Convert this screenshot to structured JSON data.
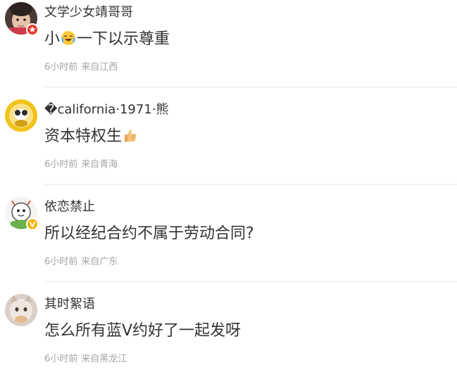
{
  "comments": [
    {
      "username": "文学少女靖哥哥",
      "content_before": "小",
      "emoji": "crying-laughing-emoji",
      "content_after": "一下以示尊重",
      "time": "6小时前",
      "location": "来自江西",
      "badge": "red-star-badge"
    },
    {
      "username": "�california·1971·熊",
      "content_before": "资本特权生",
      "emoji": "thumbs-up-emoji",
      "content_after": "",
      "time": "6小时前",
      "location": "来自青海",
      "badge": ""
    },
    {
      "username": "依恋禁止",
      "content_before": "所以经纪合约不属于劳动合同?",
      "emoji": "",
      "content_after": "",
      "time": "6小时前",
      "location": "来自广东",
      "badge": "yellow-v-badge"
    },
    {
      "username": "其时絮语",
      "content_before": "怎么所有蓝V约好了一起发呀",
      "emoji": "",
      "content_after": "",
      "time": "6小时前",
      "location": "来自黑龙江",
      "badge": ""
    }
  ],
  "colors": {
    "text": "#333333",
    "meta": "#a5a5a5",
    "divider": "#e8e8e8",
    "badge_red": "#e6392e",
    "badge_yellow": "#f4b400"
  }
}
